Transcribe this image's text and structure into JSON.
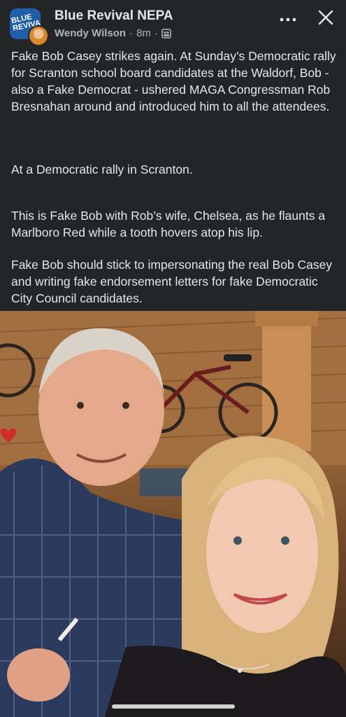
{
  "header": {
    "group_name": "Blue Revival NEPA",
    "author": "Wendy Wilson",
    "separator": "·",
    "time": "8m",
    "separator2": "·",
    "privacy_icon": "group-privacy-icon",
    "more_icon": "more-options-icon",
    "close_icon": "close-icon",
    "avatar_logo_text": "BLUE REVIVAL"
  },
  "post": {
    "paragraphs": [
      "Fake Bob Casey strikes again. At Sunday’s Democratic rally for Scranton school board candidates at the Waldorf, Bob - also a Fake Democrat - ushered MAGA Congressman Rob Bresnahan around and introduced him to all the attendees.",
      "At a Democratic rally in Scranton.",
      "This is Fake Bob with Rob’s wife, Chelsea, as he flaunts a Marlboro Red while a tooth hovers atop his lip.",
      "Fake Bob should stick to impersonating the real Bob Casey and writing fake endorsement letters for fake Democratic City Council candidates."
    ]
  },
  "photo": {
    "description_icon": "post-photo"
  },
  "colors": {
    "background": "#18191a",
    "card": "#242526",
    "text": "#e4e6eb",
    "secondary_text": "#b0b3b8",
    "brand": "#1e5fa8"
  }
}
